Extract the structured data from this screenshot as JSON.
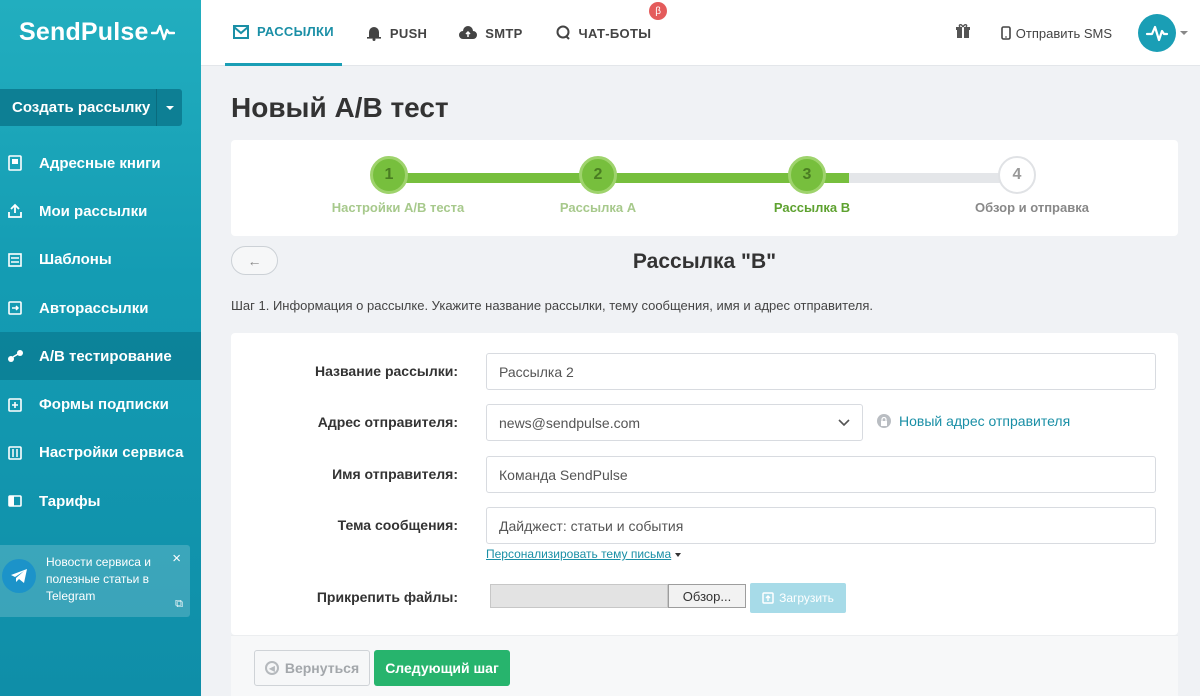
{
  "brand": {
    "logo_text": "SendPulse"
  },
  "sidebar": {
    "create_label": "Создать рассылку",
    "items": [
      {
        "label": "Адресные книги",
        "icon": "address-book-icon"
      },
      {
        "label": "Мои рассылки",
        "icon": "upload-icon"
      },
      {
        "label": "Шаблоны",
        "icon": "templates-icon"
      },
      {
        "label": "Авторассылки",
        "icon": "automation-icon"
      },
      {
        "label": "A/B тестирование",
        "icon": "ab-test-icon",
        "active": true
      },
      {
        "label": "Формы подписки",
        "icon": "subscription-form-icon"
      },
      {
        "label": "Настройки сервиса",
        "icon": "settings-icon"
      },
      {
        "label": "Тарифы",
        "icon": "pricing-icon"
      }
    ],
    "telegram": {
      "text": "Новости сервиса и полезные статьи в Telegram",
      "close": "×",
      "external": "⧉"
    }
  },
  "topbar": {
    "tabs": [
      {
        "label": "РАССЫЛКИ",
        "icon": "mail-icon",
        "active": true
      },
      {
        "label": "PUSH",
        "icon": "bell-icon"
      },
      {
        "label": "SMTP",
        "icon": "cloud-upload-icon"
      },
      {
        "label": "ЧАТ-БОТЫ",
        "icon": "chat-icon",
        "badge": "β"
      }
    ],
    "sms_label": "Отправить SMS"
  },
  "page": {
    "title": "Новый A/B тест",
    "section_title": "Рассылка \"B\"",
    "back_arrow": "←",
    "step_info": "Шаг 1. Информация о рассылке. Укажите название рассылки, тему сообщения, имя и адрес отправителя."
  },
  "stepper": {
    "steps": [
      {
        "number": "1",
        "label": "Настройки A/B теста",
        "state": "done"
      },
      {
        "number": "2",
        "label": "Рассылка A",
        "state": "done"
      },
      {
        "number": "3",
        "label": "Рассылка B",
        "state": "current"
      },
      {
        "number": "4",
        "label": "Обзор и отправка",
        "state": "todo"
      }
    ]
  },
  "form": {
    "campaign_name_label": "Название рассылки:",
    "campaign_name_value": "Рассылка 2",
    "sender_address_label": "Адрес отправителя:",
    "sender_address_value": "news@sendpulse.com",
    "new_sender_link": "Новый адрес отправителя",
    "sender_name_label": "Имя отправителя:",
    "sender_name_value": "Команда SendPulse",
    "subject_label": "Тема сообщения:",
    "subject_value": "Дайджест: статьи и события",
    "personalize_link": "Персонализировать тему письма",
    "attach_label": "Прикрепить файлы:",
    "browse_label": "Обзор...",
    "upload_label": "Загрузить"
  },
  "footer": {
    "back_label": "Вернуться",
    "next_label": "Следующий шаг"
  },
  "colors": {
    "accent": "#1a9eb5",
    "progress": "#77bf3d",
    "next_button": "#27b46d"
  }
}
